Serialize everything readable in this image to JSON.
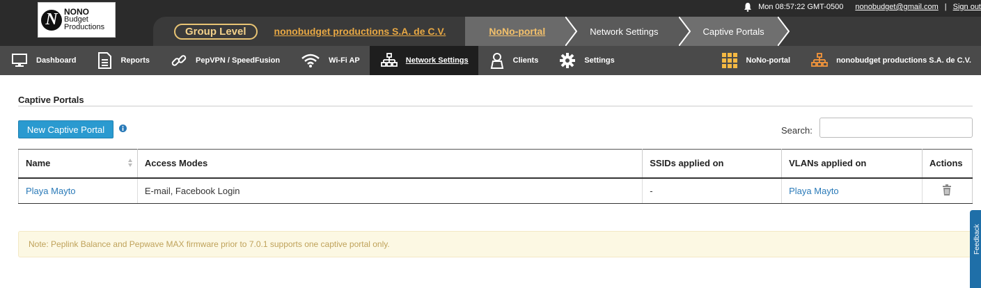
{
  "logo": {
    "line1": "NONO",
    "line2": "Budget",
    "line3": "Productions"
  },
  "userbar": {
    "time": "Mon 08:57:22 GMT-0500",
    "email": "nonobudget@gmail.com",
    "separator": "|",
    "signout": "Sign out"
  },
  "breadcrumb": {
    "level": "Group Level",
    "org": "nonobudget productions S.A. de C.V.",
    "group": "NoNo-portal",
    "network": "Network Settings",
    "current": "Captive Portals"
  },
  "nav": {
    "items": [
      {
        "label": "Dashboard",
        "icon": "monitor-icon"
      },
      {
        "label": "Reports",
        "icon": "report-icon"
      },
      {
        "label": "PepVPN / SpeedFusion",
        "icon": "link-icon"
      },
      {
        "label": "Wi-Fi AP",
        "icon": "wifi-icon"
      },
      {
        "label": "Network Settings",
        "icon": "network-icon",
        "active": true
      },
      {
        "label": "Clients",
        "icon": "user-icon"
      },
      {
        "label": "Settings",
        "icon": "gear-icon"
      }
    ],
    "right": [
      {
        "label": "NoNo-portal",
        "icon": "grid-icon"
      },
      {
        "label": "nonobudget productions S.A. de C.V.",
        "icon": "org-icon"
      }
    ]
  },
  "page": {
    "title": "Captive Portals",
    "new_button": "New Captive Portal",
    "search_label": "Search:",
    "search_value": ""
  },
  "table": {
    "headers": {
      "name": "Name",
      "access": "Access Modes",
      "ssids": "SSIDs applied on",
      "vlans": "VLANs applied on",
      "actions": "Actions"
    },
    "rows": [
      {
        "name": "Playa Mayto",
        "access": "E-mail, Facebook Login",
        "ssids": "-",
        "vlans": "Playa Mayto"
      }
    ]
  },
  "note": "Note: Peplink Balance and Pepwave MAX firmware prior to 7.0.1 supports one captive portal only.",
  "feedback": "Feedback",
  "colors": {
    "accent": "#2a9ad0",
    "link": "#2a7ab8",
    "crumb_gold": "#e8a844"
  }
}
